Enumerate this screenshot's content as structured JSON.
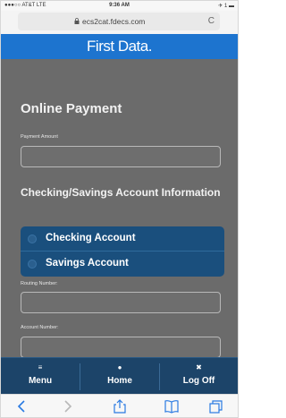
{
  "status_bar": {
    "carrier": "●●●○○ AT&T  LTE",
    "time": "9:36 AM",
    "battery": "✈ 1 ▬"
  },
  "browser": {
    "url": "ecs2cat.fdecs.com",
    "reload_glyph": "C"
  },
  "site": {
    "brand": "First Data."
  },
  "form": {
    "title": "Online Payment",
    "payment_amount_label": "Payment Amount",
    "payment_amount_value": "",
    "account_section_title": "Checking/Savings Account Information",
    "account_options": [
      "Checking Account",
      "Savings Account"
    ],
    "routing_number_label": "Routing Number:",
    "routing_number_value": "",
    "account_number_label": "Account Number:",
    "account_number_value": ""
  },
  "bottom_nav": [
    {
      "glyph": "≡",
      "label": "Menu"
    },
    {
      "glyph": "●",
      "label": "Home"
    },
    {
      "glyph": "✖",
      "label": "Log Off"
    }
  ],
  "toolbar_icons": [
    "back-icon",
    "forward-icon",
    "share-icon",
    "bookmarks-icon",
    "tabs-icon"
  ],
  "colors": {
    "brand_blue": "#1d74cf",
    "nav_dark": "#1c4469",
    "radio_group": "#1a4f7d",
    "content_bg": "#6b6b6b"
  }
}
